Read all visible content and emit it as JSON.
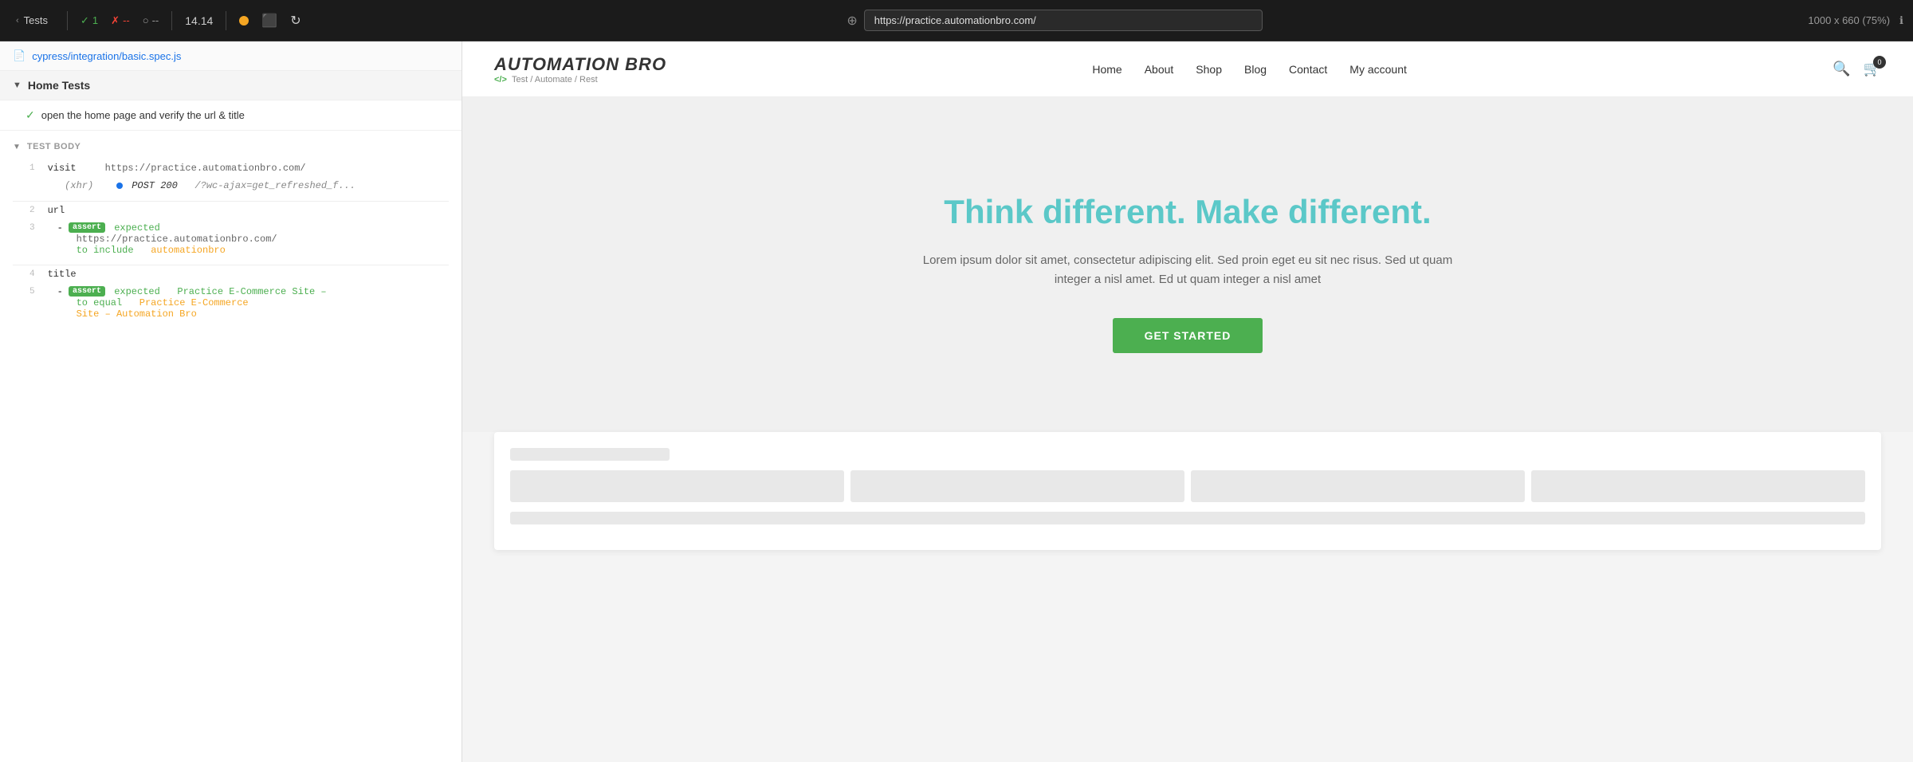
{
  "topbar": {
    "tests_label": "Tests",
    "pass_count": "1",
    "fail_count": "--",
    "pending_count": "--",
    "timer": "14.14",
    "url": "https://practice.automationbro.com/",
    "dimensions": "1000 x 660  (75%)"
  },
  "file": {
    "path": "cypress/integration/basic.spec.js"
  },
  "suite": {
    "title": "Home Tests"
  },
  "test": {
    "label": "open the home page and verify the url & title"
  },
  "testbody": {
    "header": "TEST BODY",
    "rows": [
      {
        "line": "1",
        "cmd": "visit",
        "value": "https://practice.automationbro.com/"
      },
      {
        "line": "",
        "sub": "(xhr)",
        "post": "POST 200",
        "posturl": "/?wc-ajax=get_refreshed_f..."
      },
      {
        "line": "2",
        "cmd": "url",
        "value": ""
      },
      {
        "line": "3",
        "cmd": "- assert",
        "expected": "expected",
        "url": "https://practice.automationbro.com/",
        "toinclude": "to include",
        "word": "automationbro"
      },
      {
        "line": "4",
        "cmd": "title",
        "value": ""
      },
      {
        "line": "5",
        "cmd": "- assert",
        "expected": "expected",
        "text1": "Practice E-Commerce Site –",
        "toequal": "to equal",
        "text2": "Practice E-Commerce Site – Automation Bro"
      }
    ]
  },
  "navbar": {
    "logo_name": "AUTOMATION BRO",
    "logo_code": "</>",
    "logo_tagline": "Test / Automate / Rest",
    "links": [
      "Home",
      "About",
      "Shop",
      "Blog",
      "Contact",
      "My account"
    ],
    "cart_count": "0"
  },
  "hero": {
    "title": "Think different. Make different.",
    "subtitle": "Lorem ipsum dolor sit amet, consectetur adipiscing elit. Sed proin eget eu sit nec risus. Sed ut quam integer a nisl amet.  Ed ut quam integer a nisl amet",
    "cta": "GET STARTED"
  }
}
